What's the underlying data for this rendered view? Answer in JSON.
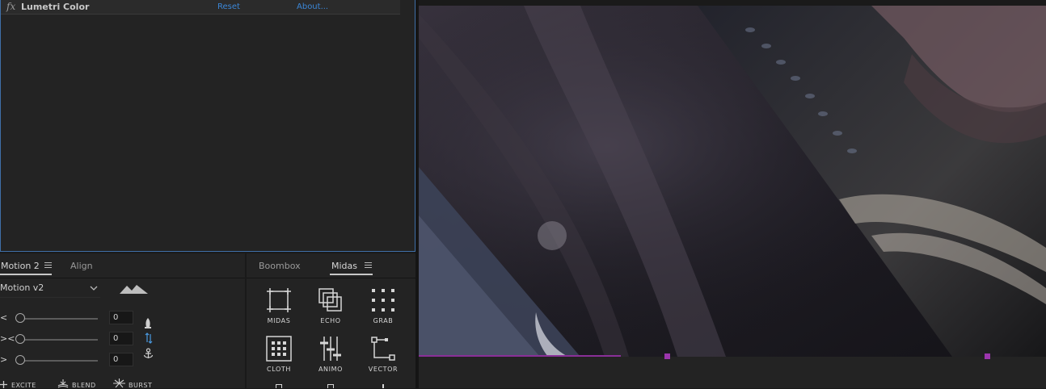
{
  "effect_controls": {
    "fx_label": "fx",
    "effect_name": "Lumetri Color",
    "reset_label": "Reset",
    "about_label": "About..."
  },
  "motion_panel": {
    "tabs": [
      {
        "label": "Motion 2",
        "active": true
      },
      {
        "label": "Align",
        "active": false
      }
    ],
    "preset_select_value": "Motion v2",
    "sliders": [
      {
        "glyph": "<",
        "value": "0"
      },
      {
        "glyph": "><",
        "value": "0"
      },
      {
        "glyph": ">",
        "value": "0"
      }
    ],
    "bottom_buttons": [
      "EXCITE",
      "BLEND",
      "BURST"
    ]
  },
  "midas_panel": {
    "tabs": [
      {
        "label": "Boombox",
        "active": false
      },
      {
        "label": "Midas",
        "active": true
      }
    ],
    "tools": [
      {
        "label": "MIDAS",
        "icon": "midas-icon"
      },
      {
        "label": "ECHO",
        "icon": "echo-icon"
      },
      {
        "label": "GRAB",
        "icon": "grab-icon"
      },
      {
        "label": "CLOTH",
        "icon": "cloth-icon"
      },
      {
        "label": "ANIMO",
        "icon": "animo-icon"
      },
      {
        "label": "VECTOR",
        "icon": "vector-icon"
      }
    ]
  },
  "colors": {
    "accent_blue": "#3b86d6",
    "panel_bg": "#232323",
    "timeline_marker": "#8a2f98"
  }
}
